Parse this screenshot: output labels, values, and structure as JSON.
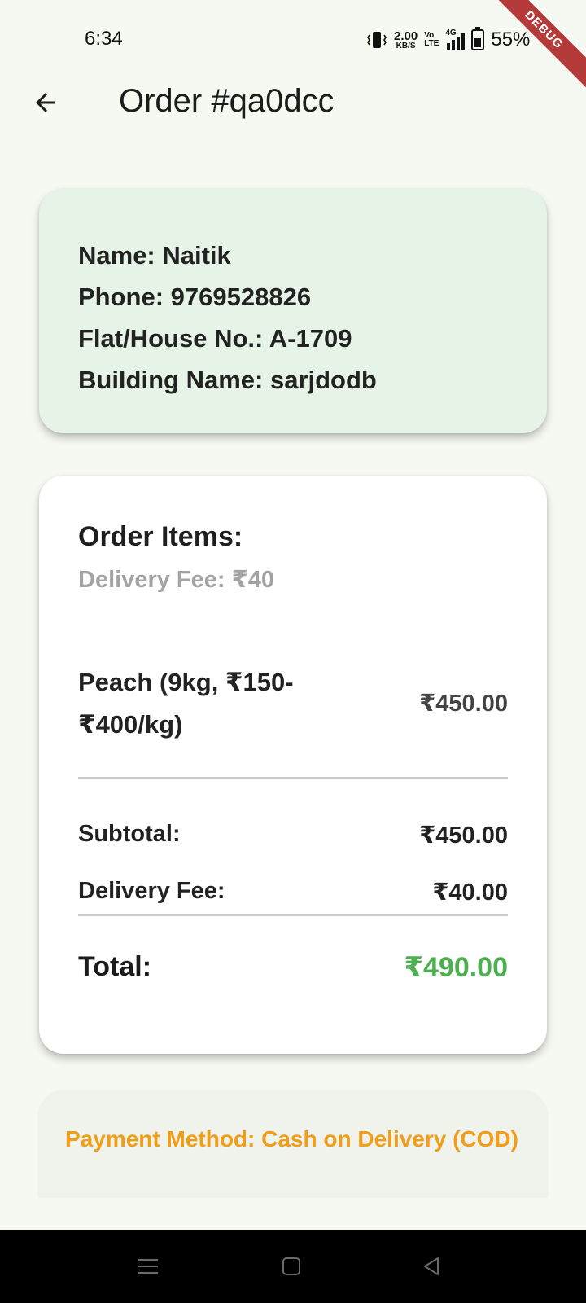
{
  "status_bar": {
    "time": "6:34",
    "net_speed_value": "2.00",
    "net_speed_unit": "KB/S",
    "volte_top": "Vo",
    "volte_bottom": "LTE",
    "network_type": "4G",
    "battery_percent": "55%",
    "battery_level": 0.55,
    "icons": [
      "vibrate-icon",
      "signal-icon",
      "battery-icon"
    ]
  },
  "debug_banner": "DEBUG",
  "app_bar": {
    "back_icon": "arrow-left-icon",
    "title": "Order #qa0dcc"
  },
  "customer": {
    "name": "Name: Naitik",
    "phone": "Phone: 9769528826",
    "flat": "Flat/House No.: A-1709",
    "building": "Building Name: sarjdodb"
  },
  "order_items": {
    "title": "Order Items:",
    "delivery_note": "Delivery Fee: ₹40",
    "items": [
      {
        "name": "Peach (9kg, ₹150-₹400/kg)",
        "price": "₹450.00"
      }
    ],
    "subtotal_label": "Subtotal:",
    "subtotal_value": "₹450.00",
    "delivery_fee_label": "Delivery Fee:",
    "delivery_fee_value": "₹40.00",
    "total_label": "Total:",
    "total_value": "₹490.00"
  },
  "payment": {
    "method": "Payment Method: Cash on Delivery (COD)"
  },
  "nav_bar": {
    "icons": [
      "menu-icon",
      "home-icon",
      "back-triangle-icon"
    ]
  },
  "colors": {
    "background": "#f6f9f1",
    "info_card": "#e6f3e7",
    "total_green": "#4caf50",
    "payment_orange": "#f29d18",
    "debug_red": "#b43a3a"
  }
}
